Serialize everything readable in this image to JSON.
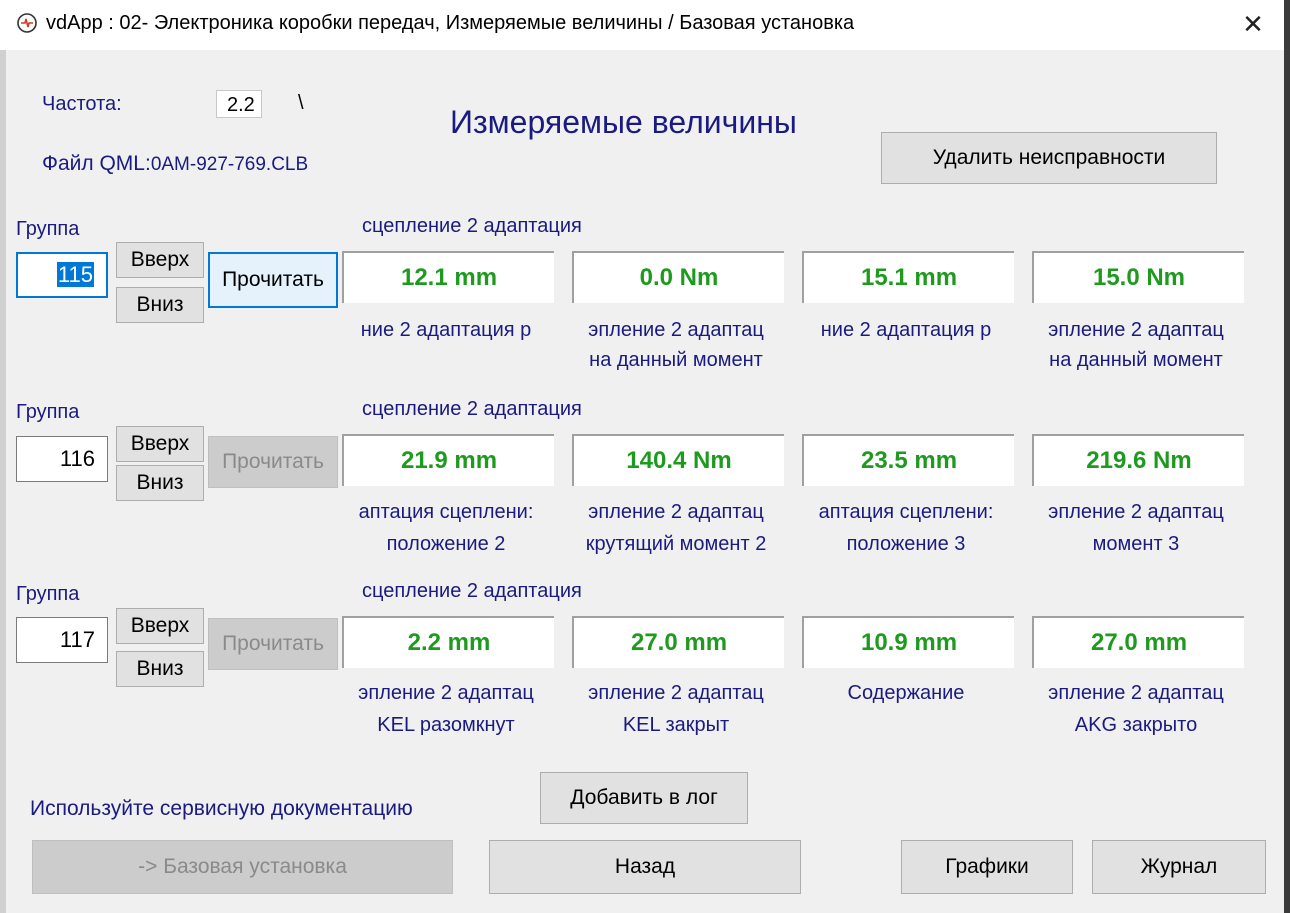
{
  "window": {
    "title": "vdApp : 02- Электроника коробки передач,  Измеряемые величины / Базовая установка",
    "close_symbol": "✕",
    "icon": "app-logo-icon"
  },
  "header": {
    "freq_label": "Частота:",
    "freq_value": "2.2",
    "freq_indicator": "\\",
    "file_label": "Файл QML:",
    "file_name": "0AM-927-769.CLB",
    "page_title": "Измеряемые величины",
    "clear_faults_label": "Удалить неисправности"
  },
  "groups": [
    {
      "label": "Группа",
      "number": "115",
      "up_label": "Вверх",
      "down_label": "Вниз",
      "read_label": "Прочитать",
      "caption": "сцепление 2 адаптация",
      "fields": [
        {
          "value": "12.1 mm",
          "line1": "ние 2 адаптация р",
          "line2": ""
        },
        {
          "value": "0.0 Nm",
          "line1": "эпление 2 адаптац",
          "line2": "на данный момент"
        },
        {
          "value": "15.1 mm",
          "line1": "ние 2 адаптация р",
          "line2": ""
        },
        {
          "value": "15.0 Nm",
          "line1": "эпление 2 адаптац",
          "line2": "на данный момент"
        }
      ]
    },
    {
      "label": "Группа",
      "number": "116",
      "up_label": "Вверх",
      "down_label": "Вниз",
      "read_label": "Прочитать",
      "caption": "сцепление 2 адаптация",
      "fields": [
        {
          "value": "21.9 mm",
          "line1": "аптация сцеплени:",
          "line2": "положение 2"
        },
        {
          "value": "140.4 Nm",
          "line1": "эпление 2 адаптац",
          "line2": "крутящий момент 2"
        },
        {
          "value": "23.5 mm",
          "line1": "аптация сцеплени:",
          "line2": "положение 3"
        },
        {
          "value": "219.6 Nm",
          "line1": "эпление 2 адаптац",
          "line2": "момент 3"
        }
      ]
    },
    {
      "label": "Группа",
      "number": "117",
      "up_label": "Вверх",
      "down_label": "Вниз",
      "read_label": "Прочитать",
      "caption": "сцепление 2 адаптация",
      "fields": [
        {
          "value": "2.2 mm",
          "line1": "эпление 2 адаптац",
          "line2": "KEL разомкнут"
        },
        {
          "value": "27.0 mm",
          "line1": "эпление 2 адаптац",
          "line2": "KEL закрыт"
        },
        {
          "value": "10.9 mm",
          "line1": "Содержание",
          "line2": ""
        },
        {
          "value": "27.0 mm",
          "line1": "эпление 2 адаптац",
          "line2": "AKG закрыто"
        }
      ]
    }
  ],
  "footer": {
    "note": "Используйте сервисную документацию",
    "add_log_label": "Добавить в лог",
    "basic_setting_label": "-> Базовая установка",
    "back_label": "Назад",
    "graphs_label": "Графики",
    "journal_label": "Журнал"
  },
  "colors": {
    "value_text": "#1e9a1e",
    "navy_text": "#1a1a80",
    "focus_blue": "#0078d7"
  }
}
